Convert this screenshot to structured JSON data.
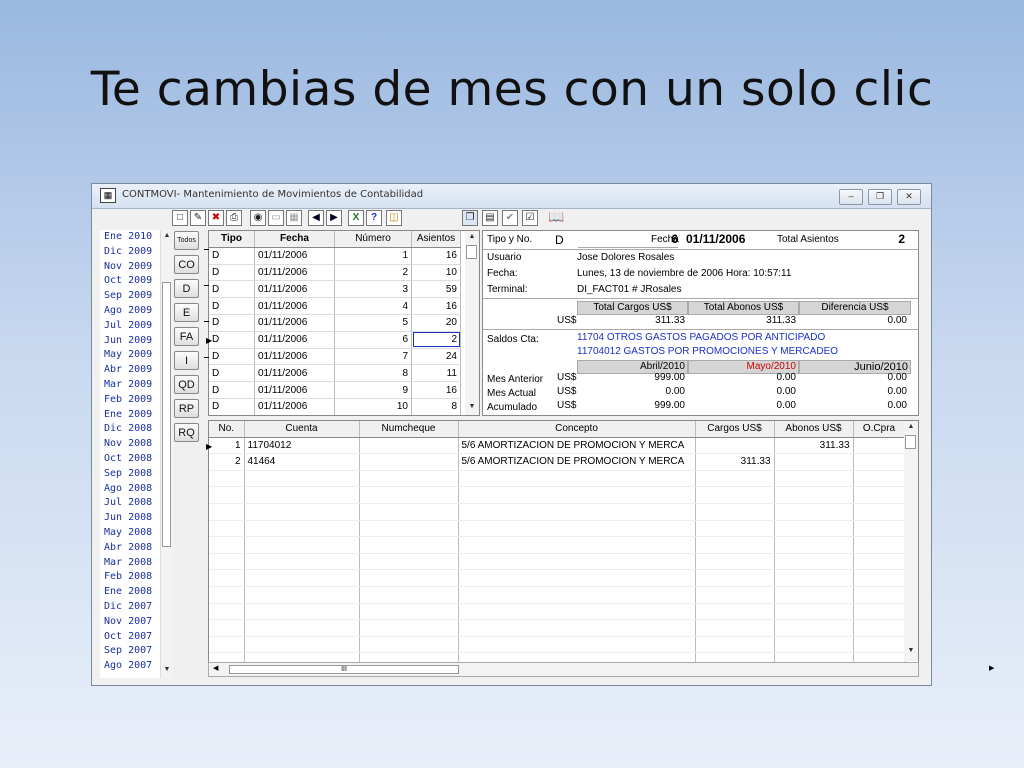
{
  "slide": {
    "title": "Te cambias de mes con un solo clic"
  },
  "window": {
    "title": "CONTMOVI- Mantenimiento de Movimientos de Contabilidad",
    "controls": {
      "minimize": "–",
      "restore": "❐",
      "close": "✕"
    }
  },
  "toolbar": {
    "icons": [
      "new-doc-icon",
      "edit-doc-icon",
      "delete-doc-icon",
      "print-icon",
      "find-icon",
      "screen-icon",
      "grid-icon",
      "first-record-icon",
      "last-record-icon",
      "excel-icon",
      "help-icon",
      "folder-icon",
      "copy-icon",
      "paste-icon",
      "ok-icon",
      "check-icon",
      "book-icon"
    ],
    "help_label": "?"
  },
  "months": [
    "Ene 2010",
    "Dic 2009",
    "Nov 2009",
    "Oct 2009",
    "Sep 2009",
    "Ago 2009",
    "Jul 2009",
    "Jun 2009",
    "May 2009",
    "Abr 2009",
    "Mar 2009",
    "Feb 2009",
    "Ene 2009",
    "Dic 2008",
    "Nov 2008",
    "Oct 2008",
    "Sep 2008",
    "Ago 2008",
    "Jul 2008",
    "Jun 2008",
    "May 2008",
    "Abr 2008",
    "Mar 2008",
    "Feb 2008",
    "Ene 2008",
    "Dic 2007",
    "Nov 2007",
    "Oct 2007",
    "Sep 2007",
    "Ago 2007"
  ],
  "filters": [
    "Todos",
    "CO",
    "D",
    "E",
    "FA",
    "I",
    "QD",
    "RP",
    "RQ"
  ],
  "top_grid": {
    "columns": [
      "Tipo",
      "Fecha",
      "Número",
      "Asientos"
    ],
    "rows": [
      {
        "tipo": "D",
        "fecha": "01/11/2006",
        "numero": "1",
        "asientos": "16"
      },
      {
        "tipo": "D",
        "fecha": "01/11/2006",
        "numero": "2",
        "asientos": "10"
      },
      {
        "tipo": "D",
        "fecha": "01/11/2006",
        "numero": "3",
        "asientos": "59"
      },
      {
        "tipo": "D",
        "fecha": "01/11/2006",
        "numero": "4",
        "asientos": "16"
      },
      {
        "tipo": "D",
        "fecha": "01/11/2006",
        "numero": "5",
        "asientos": "20"
      },
      {
        "tipo": "D",
        "fecha": "01/11/2006",
        "numero": "6",
        "asientos": "2"
      },
      {
        "tipo": "D",
        "fecha": "01/11/2006",
        "numero": "7",
        "asientos": "24"
      },
      {
        "tipo": "D",
        "fecha": "01/11/2006",
        "numero": "8",
        "asientos": "11"
      },
      {
        "tipo": "D",
        "fecha": "01/11/2006",
        "numero": "9",
        "asientos": "16"
      },
      {
        "tipo": "D",
        "fecha": "01/11/2006",
        "numero": "10",
        "asientos": "8"
      }
    ]
  },
  "detail": {
    "tipo_label": "Tipo y No.",
    "tipo_value": "D",
    "no_value": "6",
    "fecha_label": "Fecha",
    "fecha_value": "01/11/2006",
    "total_label": "Total Asientos",
    "total_value": "2",
    "usuario_label": "Usuario",
    "usuario_value": "Jose Dolores Rosales",
    "fecha2_label": "Fecha:",
    "fecha2_value": "Lunes, 13 de noviembre de 2006 Hora: 10:57:11",
    "terminal_label": "Terminal:",
    "terminal_value": "DI_FACT01 # JRosales",
    "totals_headers": [
      "Total Cargos US$",
      "Total Abonos US$",
      "Diferencia US$"
    ],
    "currency": "US$",
    "totals_values": [
      "311.33",
      "311.33",
      "0.00"
    ],
    "saldos_label": "Saldos Cta:",
    "saldos_line1": "11704 OTROS GASTOS PAGADOS POR ANTICIPADO",
    "saldos_line2": "11704012 GASTOS POR PROMOCIONES Y MERCADEO",
    "month_headers": [
      "Abril/2010",
      "Mayo/2010",
      "Junio/2010"
    ],
    "saldo_rows": [
      {
        "label": "Mes Anterior",
        "cur": "US$",
        "v": [
          "999.00",
          "0.00",
          "0.00"
        ]
      },
      {
        "label": "Mes Actual",
        "cur": "US$",
        "v": [
          "0.00",
          "0.00",
          "0.00"
        ]
      },
      {
        "label": "Acumulado",
        "cur": "US$",
        "v": [
          "999.00",
          "0.00",
          "0.00"
        ]
      }
    ]
  },
  "bottom_grid": {
    "columns": [
      "No.",
      "Cuenta",
      "Numcheque",
      "Concepto",
      "Cargos US$",
      "Abonos US$",
      "O.Cpra"
    ],
    "rows": [
      {
        "no": "1",
        "cuenta": "11704012",
        "numcheque": "",
        "concepto": "5/6 AMORTIZACION DE PROMOCION Y MERCA",
        "cargos": "",
        "abonos": "311.33",
        "ocpra": ""
      },
      {
        "no": "2",
        "cuenta": "41464",
        "numcheque": "",
        "concepto": "5/6 AMORTIZACION DE PROMOCION Y MERCA",
        "cargos": "311.33",
        "abonos": "",
        "ocpra": ""
      }
    ],
    "hscroll_label": "III"
  }
}
